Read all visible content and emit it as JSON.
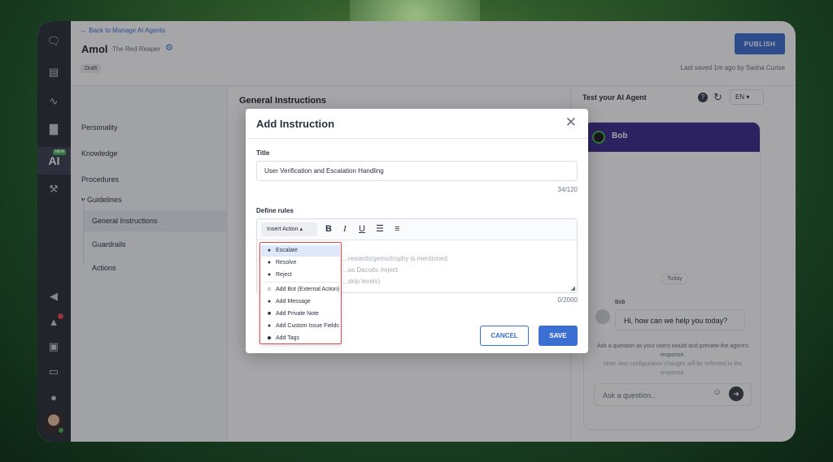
{
  "header": {
    "back_label": "Back to Manage AI Agents",
    "agent_name": "Amol",
    "agent_subtitle": "The Red Reaper",
    "status_badge": "Draft",
    "publish_label": "PUBLISH",
    "last_saved": "Last saved 1m ago by Sasha Curise"
  },
  "nav": {
    "ai_label": "AI",
    "new_badge": "NEW"
  },
  "sidebar": {
    "items": [
      {
        "label": "Personality"
      },
      {
        "label": "Knowledge"
      },
      {
        "label": "Procedures"
      },
      {
        "label": "Guidelines"
      },
      {
        "label": "General Instructions"
      },
      {
        "label": "Guardrails"
      },
      {
        "label": "Actions"
      }
    ]
  },
  "center": {
    "heading": "General Instructions"
  },
  "preview": {
    "title": "Test your AI Agent",
    "language": "EN",
    "bot_name": "Bob",
    "today_label": "Today",
    "message_sender": "Bob",
    "bot_message": "Hi, how can we help you today?",
    "hint": "Ask a question as your users would and preview the agent's response.",
    "hint_sub": "Note: Any configuration changes will be reflected in the response.",
    "input_placeholder": "Ask a question..."
  },
  "modal": {
    "title": "Add Instruction",
    "title_label": "Title",
    "title_value": "User Verification and Escalation Handling",
    "title_counter": "34/120",
    "rules_label": "Define rules",
    "insert_action_label": "Insert Action",
    "editor_lines": [
      "...rewards/gems/trophy is mentioned",
      "...as Dacoits /reject",
      "...skip levels)"
    ],
    "rules_counter": "0/2000",
    "cancel_label": "CANCEL",
    "save_label": "SAVE"
  },
  "insert_menu": {
    "items": [
      {
        "label": "Escalate",
        "icon": "escalate-icon"
      },
      {
        "label": "Resolve",
        "icon": "resolve-icon"
      },
      {
        "label": "Reject",
        "icon": "reject-icon"
      },
      {
        "label": "Add Bot (External Action)",
        "icon": "bot-icon"
      },
      {
        "label": "Add Message",
        "icon": "message-icon"
      },
      {
        "label": "Add Private Note",
        "icon": "note-icon"
      },
      {
        "label": "Add Custom Issue Fields",
        "icon": "fields-icon"
      },
      {
        "label": "Add Tags",
        "icon": "tag-icon"
      }
    ],
    "active_index": 0
  },
  "colors": {
    "accent": "#3b6fd1",
    "chat_header": "#3d2a8c",
    "dropdown_border": "#e5484d"
  }
}
